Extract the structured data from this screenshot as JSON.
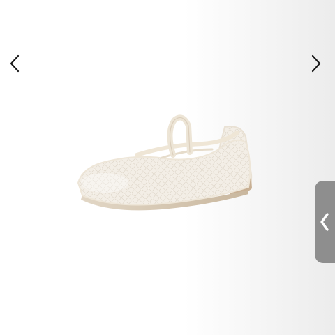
{
  "carousel": {
    "prev_icon": "chevron-left-icon",
    "next_icon": "chevron-right-icon",
    "arrow_color": "#1a1a1a"
  },
  "product_image": {
    "subject": "ballet-flat-shoe",
    "color": "#efe8dc"
  },
  "side_tab": {
    "icon": "chevron-left-icon",
    "background": "#8e8e8e",
    "icon_color": "#ffffff"
  }
}
